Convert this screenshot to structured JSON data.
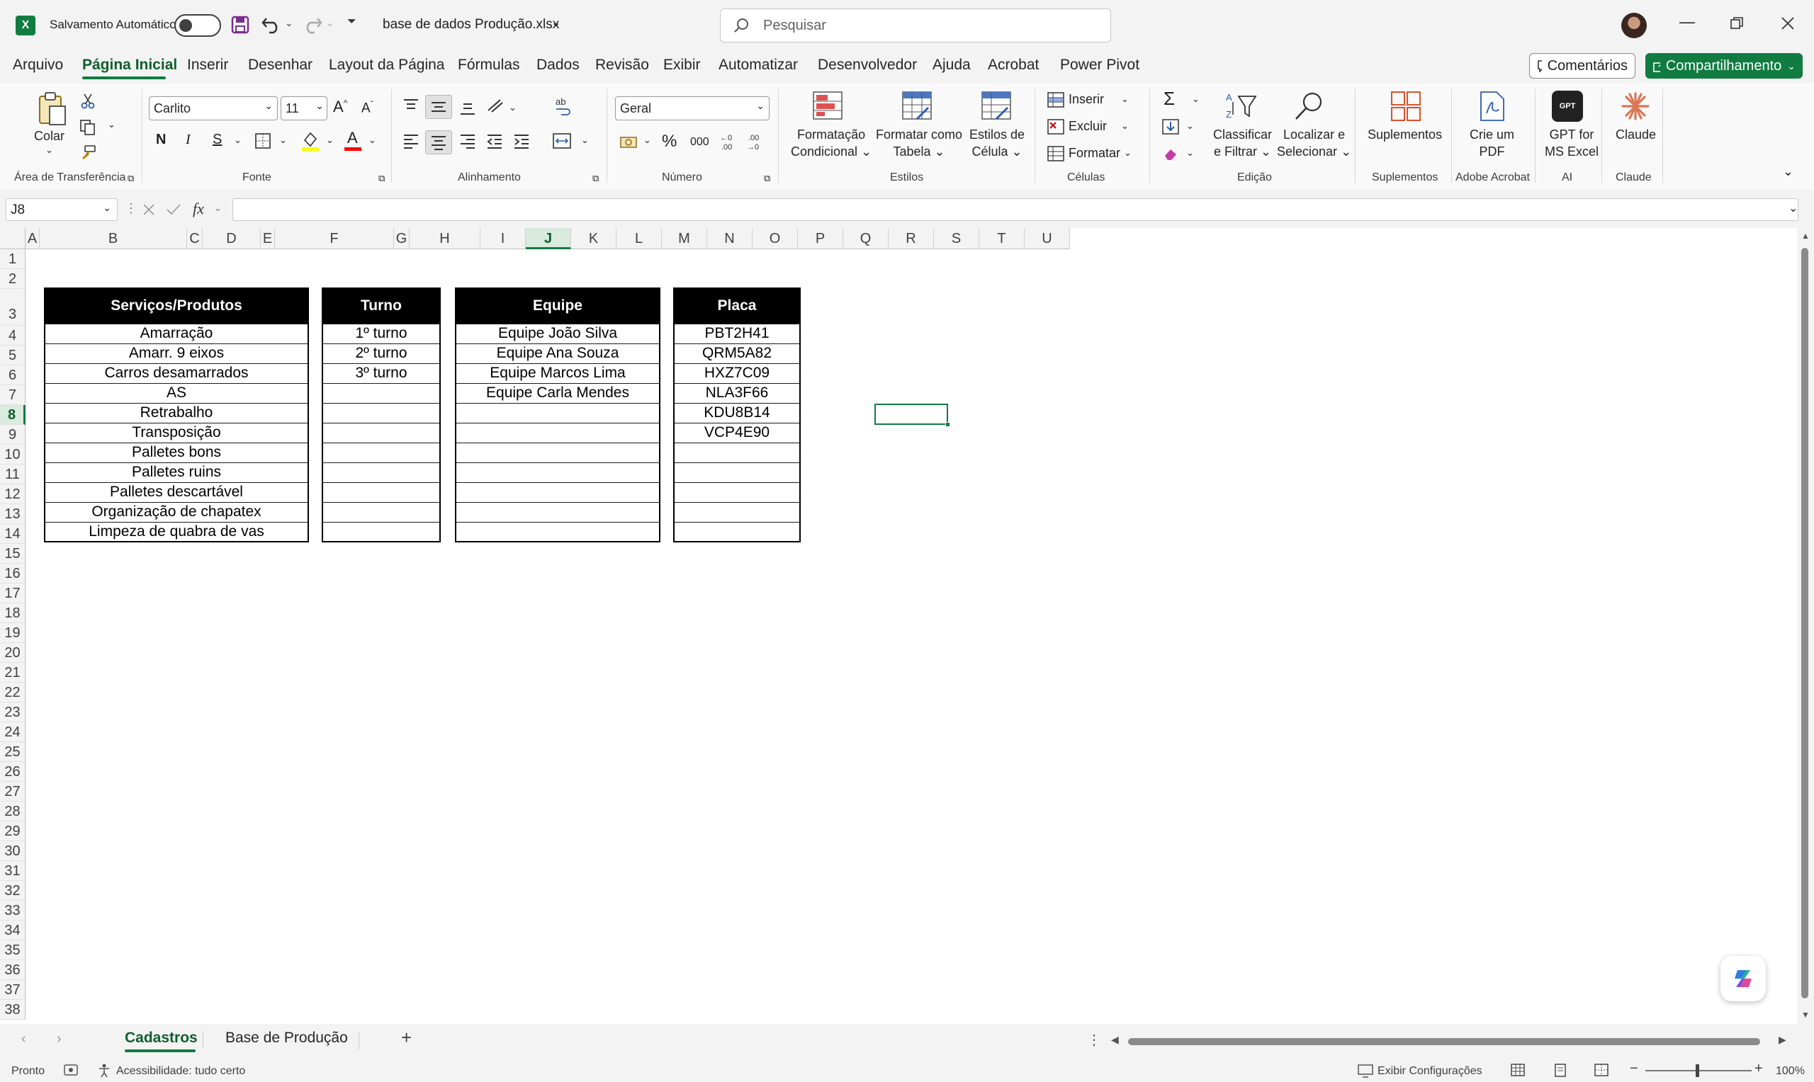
{
  "titlebar": {
    "autosave_label": "Salvamento Automático",
    "filename": "base de dados Produção.xlsx",
    "search_placeholder": "Pesquisar"
  },
  "menu": {
    "tabs": [
      "Arquivo",
      "Página Inicial",
      "Inserir",
      "Desenhar",
      "Layout da Página",
      "Fórmulas",
      "Dados",
      "Revisão",
      "Exibir",
      "Automatizar",
      "Desenvolvedor",
      "Ajuda",
      "Acrobat",
      "Power Pivot"
    ],
    "comments": "Comentários",
    "share": "Compartilhamento"
  },
  "ribbon": {
    "paste": "Colar",
    "font_name": "Carlito",
    "font_size": "11",
    "bold": "N",
    "italic": "I",
    "underline": "S",
    "number_format": "Geral",
    "percent": "%",
    "thousands": "000",
    "cond_format": [
      "Formatação",
      "Condicional"
    ],
    "format_table": [
      "Formatar como",
      "Tabela"
    ],
    "cell_styles": [
      "Estilos de",
      "Célula"
    ],
    "insert": "Inserir",
    "delete": "Excluir",
    "format": "Formatar",
    "sort_filter": [
      "Classificar",
      "e Filtrar"
    ],
    "find_select": [
      "Localizar e",
      "Selecionar"
    ],
    "addins": "Suplementos",
    "create_pdf": [
      "Crie um",
      "PDF"
    ],
    "gpt": [
      "GPT for",
      "MS Excel"
    ],
    "claude": "Claude",
    "groups": {
      "clipboard": "Área de Transferência",
      "font": "Fonte",
      "alignment": "Alinhamento",
      "number": "Número",
      "styles": "Estilos",
      "cells": "Células",
      "editing": "Edição",
      "addins": "Suplementos",
      "acrobat": "Adobe Acrobat",
      "ai": "AI",
      "claude": "Claude"
    }
  },
  "formula_bar": {
    "name_box": "J8",
    "formula": ""
  },
  "grid": {
    "columns": [
      "A",
      "B",
      "C",
      "D",
      "E",
      "F",
      "G",
      "H",
      "I",
      "J",
      "K",
      "L",
      "M",
      "N",
      "O",
      "P",
      "Q",
      "R",
      "S",
      "T",
      "U"
    ],
    "selected_column": "J",
    "selected_row": "8",
    "rows": [
      "1",
      "2",
      "3",
      "4",
      "5",
      "6",
      "7",
      "8",
      "9",
      "10",
      "11",
      "12",
      "13",
      "14",
      "15",
      "16",
      "17",
      "18",
      "19",
      "20",
      "21",
      "22",
      "23",
      "24",
      "25",
      "26",
      "27",
      "28",
      "29",
      "30",
      "31",
      "32",
      "33",
      "34",
      "35",
      "36",
      "37",
      "38"
    ]
  },
  "tables": {
    "servicos": {
      "header": "Serviços/Produtos",
      "rows": [
        "Amarração",
        "Amarr. 9 eixos",
        "Carros desamarrados",
        "AS",
        "Retrabalho",
        "Transposição",
        "Palletes bons",
        "Palletes ruins",
        "Palletes descartável",
        "Organização de chapatex",
        "Limpeza de quabra de vas"
      ]
    },
    "turno": {
      "header": "Turno",
      "rows": [
        "1º turno",
        "2º turno",
        "3º turno",
        "",
        "",
        "",
        "",
        "",
        "",
        "",
        ""
      ]
    },
    "equipe": {
      "header": "Equipe",
      "rows": [
        "Equipe João Silva",
        "Equipe Ana Souza",
        "Equipe Marcos Lima",
        "Equipe Carla Mendes",
        "",
        "",
        "",
        "",
        "",
        "",
        ""
      ]
    },
    "placa": {
      "header": "Placa",
      "rows": [
        "PBT2H41",
        "QRM5A82",
        "HXZ7C09",
        "NLA3F66",
        "KDU8B14",
        "VCP4E90",
        "",
        "",
        "",
        "",
        ""
      ]
    }
  },
  "sheet_tabs": [
    "Cadastros",
    "Base de Produção"
  ],
  "status": {
    "ready": "Pronto",
    "accessibility": "Acessibilidade: tudo certo",
    "display_settings": "Exibir Configurações",
    "zoom": "100%"
  },
  "colors": {
    "accent": "#107c41",
    "table_header_bg": "#000000"
  }
}
